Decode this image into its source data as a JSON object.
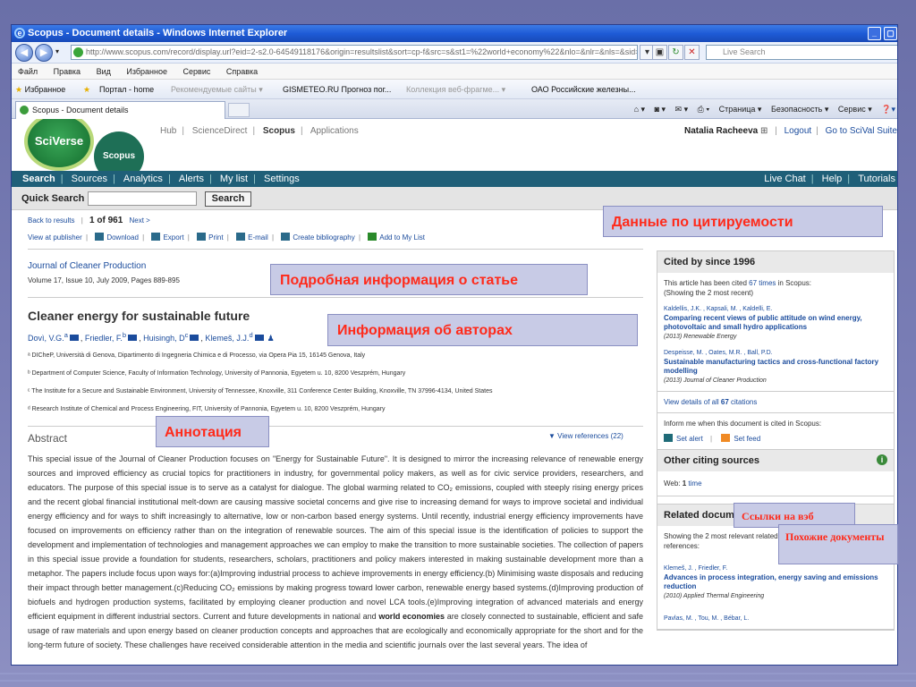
{
  "window": {
    "title": "Scopus - Document details - Windows Internet Explorer",
    "url": "http://www.scopus.com/record/display.url?eid=2-s2.0-64549118176&origin=resultslist&sort=cp-f&src=s&st1=%22world+economy%22&nlo=&nlr=&nls=&sid=",
    "live_search_placeholder": "Live Search"
  },
  "menu": [
    "Файл",
    "Правка",
    "Вид",
    "Избранное",
    "Сервис",
    "Справка"
  ],
  "favorites": {
    "label": "Избранное",
    "items": [
      "Портал - home",
      "Рекомендуемые сайты ▾",
      "GISMETEO.RU Прогноз пог...",
      "Коллекция веб-фрагме... ▾",
      "ОАО Российские железны..."
    ]
  },
  "tab": {
    "label": "Scopus - Document details"
  },
  "commands": [
    "Страница ▾",
    "Безопасность ▾",
    "Сервис ▾"
  ],
  "site": {
    "logo_main": "SciVerse",
    "logo_sub": "Scopus",
    "top_links": [
      "Hub",
      "ScienceDirect",
      "Scopus",
      "Applications"
    ],
    "user": "Natalia Racheeva",
    "logout": "Logout",
    "scival": "Go to SciVal Suite",
    "nav": [
      "Search",
      "Sources",
      "Analytics",
      "Alerts",
      "My list",
      "Settings"
    ],
    "nav_right": [
      "Live Chat",
      "Help",
      "Tutorials"
    ],
    "quick_search_label": "Quick Search",
    "search_button": "Search"
  },
  "doc": {
    "back": "Back to results",
    "position": "1 of 961",
    "next": "Next >",
    "actions": [
      "View at publisher",
      "Download",
      "Export",
      "Print",
      "E-mail",
      "Create bibliography",
      "Add to My List"
    ],
    "journal": "Journal of Cleaner Production",
    "volume": "Volume 17, Issue 10, July 2009, Pages 889-895",
    "title": "Cleaner energy for sustainable future",
    "authors": [
      {
        "name": "Dovì, V.G.",
        "sup": "a"
      },
      {
        "name": "Friedler, F.",
        "sup": "b"
      },
      {
        "name": "Huisingh, D",
        "sup": "c"
      },
      {
        "name": "Klemeš, J.J.",
        "sup": "d"
      }
    ],
    "affiliations": [
      "ᵃ DICheP, Università di Genova, Dipartimento di Ingegneria Chimica e di Processo, via Opera Pia 15, 16145 Genova, Italy",
      "ᵇ Department of Computer Science, Faculty of Information Technology, University of Pannonia, Egyetem u. 10, 8200 Veszprém, Hungary",
      "ᶜ The Institute for a Secure and Sustainable Environment, University of Tennessee, Knoxville, 311 Conference Center Building, Knoxville, TN 37996-4134, United States",
      "ᵈ Research Institute of Chemical and Process Engineering, FIT, University of Pannonia, Egyetem u. 10, 8200 Veszprém, Hungary"
    ],
    "abstract_heading": "Abstract",
    "view_references": "View references (22)",
    "abstract_p1": "This special issue of the Journal of Cleaner Production focuses on \"Energy for Sustainable Future\". It is designed to mirror the increasing relevance of renewable energy sources and improved efficiency as crucial topics for practitioners in industry, for governmental policy makers, as well as for civic service providers, researchers, and educators. The purpose of this special issue is to serve as a catalyst for dialogue. The global warming related to CO₂ emissions, coupled with steeply rising energy prices and the recent global financial institutional melt-down are causing massive societal concerns and give rise to increasing demand for ways to improve societal and individual energy efficiency and for ways to shift increasingly to alternative, low or non-carbon based energy systems. Until recently, industrial energy efficiency improvements have focused on improvements on efficiency rather than on the integration of renewable sources. The aim of this special issue is the identification of policies to support the development and implementation of technologies and management approaches we can employ to make the transition to more sustainable societies. The collection of papers in this special issue provide a foundation for students, researchers, scholars, practitioners and policy makers interested in making sustainable development more than a metaphor. The papers include focus upon ways for:(a)Improving industrial process to achieve improvements in energy efficiency.(b) Minimising waste disposals and reducing their impact through better management.(c)Reducing CO₂ emissions by making progress toward lower carbon, renewable energy based systems.(d)Improving production of biofuels and hydrogen production systems, facilitated by employing cleaner production and novel LCA tools.(e)Improving integration of advanced materials and energy efficient equipment in different industrial sectors. Current and future developments in national and ",
    "abstract_bold": "world economies",
    "abstract_p2": " are closely connected to sustainable, efficient and safe usage of raw materials and upon energy based on cleaner production concepts and approaches that are ecologically and economically appropriate for the short and for the long-term future of society. These challenges have received considerable attention in the media and scientific journals over the last several years. The idea of"
  },
  "sidebar": {
    "cited_heading": "Cited by since 1996",
    "cited_text_a": "This article has been cited ",
    "cited_count": "67 times",
    "cited_text_b": " in Scopus:",
    "cited_showing": "(Showing the 2 most recent)",
    "citations": [
      {
        "authors": "Kaldellis, J.K. , Kapsali, M. , Kaldelli, E.",
        "title": "Comparing recent views of public attitude on wind energy, photovoltaic and small hydro applications",
        "source": "(2013) Renewable Energy"
      },
      {
        "authors": "Despeisse, M. , Oates, M.R. , Ball, P.D.",
        "title": "Sustainable manufacturing tactics and cross-functional factory modelling",
        "source": "(2013) Journal of Cleaner Production"
      }
    ],
    "view_all_a": "View details of all ",
    "view_all_count": "67",
    "view_all_b": " citations",
    "inform": "Inform me when this document is cited in Scopus:",
    "set_alert": "Set alert",
    "set_feed": "Set feed",
    "other_heading": "Other citing sources",
    "web_label": "Web: ",
    "web_count": "1",
    "web_time": " time",
    "related_heading": "Related documents",
    "related_text": "Showing the 2 most relevant related documents by all shared references:",
    "related": [
      {
        "authors": "Klemeš, J. , Friedler, F.",
        "title": "Advances in process integration, energy saving and emissions reduction",
        "source": "(2010) Applied Thermal Engineering"
      },
      {
        "authors": "Pavlas, M. , Tou, M. , Bébar, L.",
        "title": "",
        "source": ""
      }
    ]
  },
  "annotations": {
    "citation_data": "Данные по цитируемости",
    "article_info": "Подробная информация о статье",
    "author_info": "Информация об авторах",
    "abstract": "Аннотация",
    "web_links": "Ссылки на вэб",
    "similar_docs": "Похожие документы"
  },
  "colors": {
    "link": "#1a4b9c",
    "nav": "#1f5f78",
    "annotation_text": "#ff2a1a",
    "titlebar": "#1e5bd6"
  }
}
